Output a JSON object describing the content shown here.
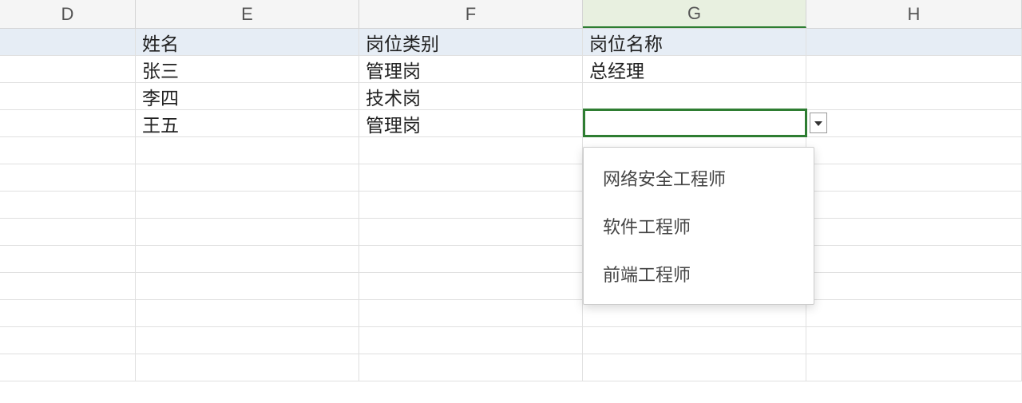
{
  "columns": {
    "D": "D",
    "E": "E",
    "F": "F",
    "G": "G",
    "H": "H"
  },
  "selected_column": "G",
  "table": {
    "header": {
      "name": "姓名",
      "job_category": "岗位类别",
      "job_title": "岗位名称"
    },
    "rows": [
      {
        "name": "张三",
        "job_category": "管理岗",
        "job_title": "总经理"
      },
      {
        "name": "李四",
        "job_category": "技术岗",
        "job_title": ""
      },
      {
        "name": "王五",
        "job_category": "管理岗",
        "job_title": ""
      }
    ]
  },
  "active_cell": "G4",
  "dropdown": {
    "options": [
      "网络安全工程师",
      "软件工程师",
      "前端工程师"
    ]
  }
}
